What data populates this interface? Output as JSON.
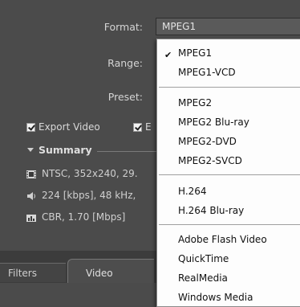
{
  "labels": {
    "format": "Format:",
    "range": "Range:",
    "preset": "Preset:"
  },
  "format_combo": {
    "value": "MPEG1"
  },
  "checkboxes": {
    "export_video": "Export Video",
    "export_audio_partial": "E"
  },
  "summary": {
    "title": "Summary",
    "video_line": "NTSC, 352x240, 29.",
    "audio_line": "224 [kbps], 48 kHz,",
    "bitrate_line": "CBR, 1.70 [Mbps]"
  },
  "tabs": {
    "filters": "Filters",
    "video": "Video"
  },
  "menu": {
    "selected": "MPEG1",
    "items": [
      "MPEG1",
      "MPEG1-VCD",
      "MPEG2",
      "MPEG2 Blu-ray",
      "MPEG2-DVD",
      "MPEG2-SVCD",
      "H.264",
      "H.264 Blu-ray",
      "Adobe Flash Video",
      "QuickTime",
      "RealMedia",
      "Windows Media"
    ]
  }
}
